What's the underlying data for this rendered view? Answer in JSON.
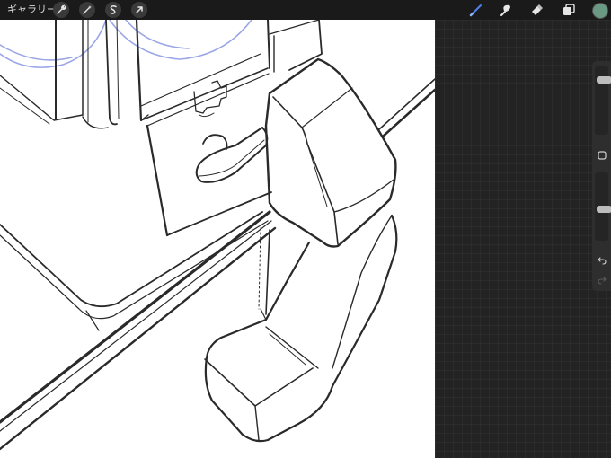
{
  "topbar": {
    "gallery_label": "ギャラリー",
    "left_tools": [
      {
        "icon": "wrench-icon",
        "name": "actions"
      },
      {
        "icon": "magic-wand-icon",
        "name": "adjustments"
      },
      {
        "icon": "selection-s-icon",
        "name": "selection"
      },
      {
        "icon": "arrow-cursor-icon",
        "name": "transform"
      }
    ],
    "right_tools": [
      {
        "icon": "brush-icon",
        "name": "brush",
        "active": true
      },
      {
        "icon": "smudge-icon",
        "name": "smudge"
      },
      {
        "icon": "eraser-icon",
        "name": "eraser"
      },
      {
        "icon": "layers-icon",
        "name": "layers"
      }
    ],
    "active_color": "#6a9a84"
  },
  "sidebar": {
    "brush_size_level": 0.84,
    "opacity_level": 0.45,
    "buttons": [
      "modify-square-icon",
      "undo-icon",
      "redo-icon"
    ]
  },
  "colors": {
    "canvas": "#ffffff",
    "panel": "#232323",
    "sketch_line": "#2a2a2a",
    "guide_line": "#9aa6e6",
    "active_tool": "#4e7ee6"
  }
}
